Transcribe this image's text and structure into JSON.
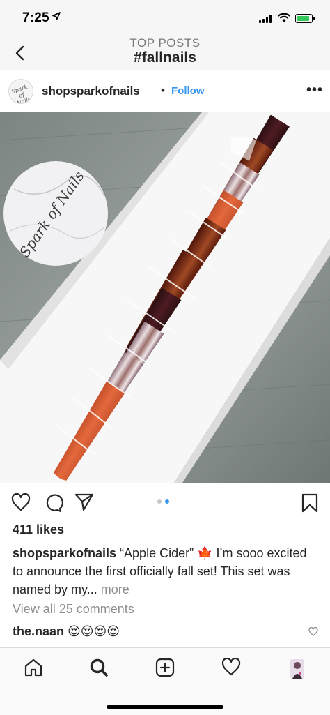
{
  "status_bar": {
    "time": "7:25",
    "battery_color": "#34c759"
  },
  "header": {
    "subtitle": "TOP POSTS",
    "title": "#fallnails",
    "back_icon": "chevron-left-icon"
  },
  "post": {
    "username": "shopsparkofnails",
    "follow_label": "Follow",
    "avatar_text": "Spark of Nails",
    "photo_sign_text": "Spark of Nails",
    "likes": "411 likes",
    "caption_user": "shopsparkofnails",
    "caption_text": " “Apple Cider” 🍁 I’m sooo excited to announce the first officially fall set! This set was named by my... ",
    "caption_more": "more",
    "view_comments": "View all 25 comments",
    "comment_user": "the.naan",
    "comment_text": " 😍😍😍😍",
    "carousel": {
      "count": 2,
      "active_index": 1
    }
  },
  "tab_bar": {
    "items": [
      "home-icon",
      "search-icon",
      "new-post-icon",
      "activity-heart-icon",
      "profile-avatar"
    ],
    "active": "search-icon"
  },
  "colors": {
    "accent": "#3897f0",
    "text": "#262626",
    "muted": "#8e8e8e"
  }
}
